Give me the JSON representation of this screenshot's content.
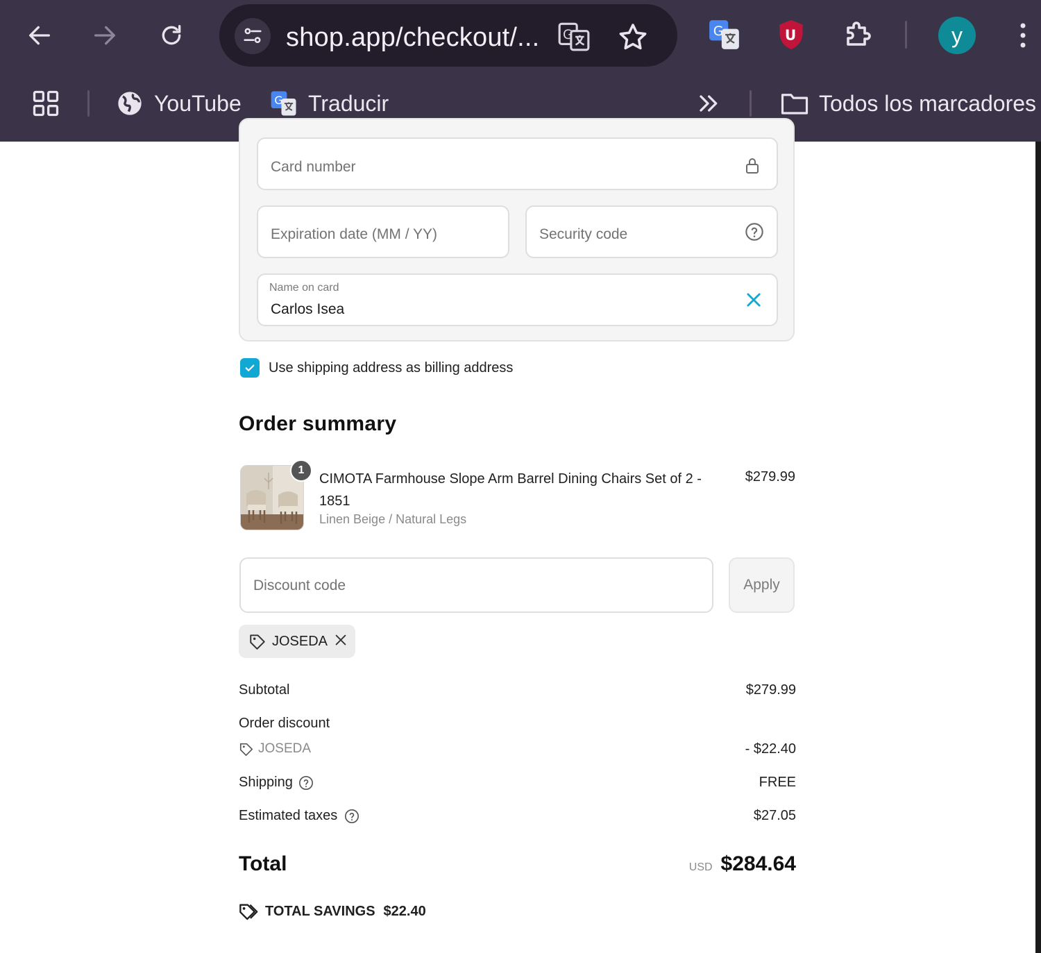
{
  "browser": {
    "url": "shop.app/checkout/...",
    "avatar_letter": "y",
    "bookmarks": [
      {
        "label": "YouTube",
        "icon": "globe-icon"
      },
      {
        "label": "Traducir",
        "icon": "google-translate-icon"
      }
    ],
    "all_bookmarks_label": "Todos los marcadores",
    "colors": {
      "chrome_bg": "#3b3347",
      "omnibox_bg": "#231d2b",
      "avatar_bg": "#0f8b98"
    }
  },
  "payment": {
    "card_number_placeholder": "Card number",
    "expiration_placeholder": "Expiration date (MM / YY)",
    "security_placeholder": "Security code",
    "name_label": "Name on card",
    "name_value": "Carlos Isea",
    "billing_label": "Use shipping address as billing address",
    "billing_checked": true
  },
  "summary": {
    "heading": "Order summary",
    "product": {
      "quantity": "1",
      "title": "CIMOTA Farmhouse Slope Arm Barrel Dining Chairs Set of 2 - 1851",
      "variant": "Linen Beige / Natural Legs",
      "price": "$279.99"
    },
    "discount_placeholder": "Discount code",
    "apply_label": "Apply",
    "applied_code": "JOSEDA",
    "subtotal_label": "Subtotal",
    "subtotal_value": "$279.99",
    "order_discount_label": "Order discount",
    "order_discount_code": "JOSEDA",
    "order_discount_value": "- $22.40",
    "shipping_label": "Shipping",
    "shipping_value": "FREE",
    "taxes_label": "Estimated taxes",
    "taxes_value": "$27.05",
    "total_label": "Total",
    "currency": "USD",
    "total_value": "$284.64",
    "savings_label": "TOTAL SAVINGS",
    "savings_value": "$22.40"
  }
}
